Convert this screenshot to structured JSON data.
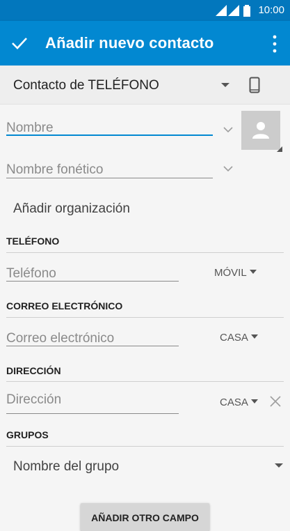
{
  "status_bar": {
    "time": "10:00"
  },
  "app_bar": {
    "title": "Añadir nuevo contacto"
  },
  "account": {
    "label": "Contacto de TELÉFONO"
  },
  "name": {
    "placeholder": "Nombre",
    "phonetic_placeholder": "Nombre fonético"
  },
  "organization": {
    "label": "Añadir organización"
  },
  "phone": {
    "header": "TELÉFONO",
    "placeholder": "Teléfono",
    "type": "MÓVIL"
  },
  "email": {
    "header": "CORREO ELECTRÓNICO",
    "placeholder": "Correo electrónico",
    "type": "CASA"
  },
  "address": {
    "header": "DIRECCIÓN",
    "placeholder": "Dirección",
    "type": "CASA"
  },
  "groups": {
    "header": "GRUPOS",
    "placeholder": "Nombre del grupo"
  },
  "add_field_button": {
    "label": "AÑADIR OTRO CAMPO"
  },
  "colors": {
    "status_bar": "#0277bd",
    "app_bar": "#0288d1",
    "accent": "#0288d1"
  },
  "icons": [
    "signal-icon",
    "battery-icon",
    "check-icon",
    "more-vert-icon",
    "phone-device-icon",
    "chevron-down-icon",
    "person-icon",
    "close-icon"
  ]
}
